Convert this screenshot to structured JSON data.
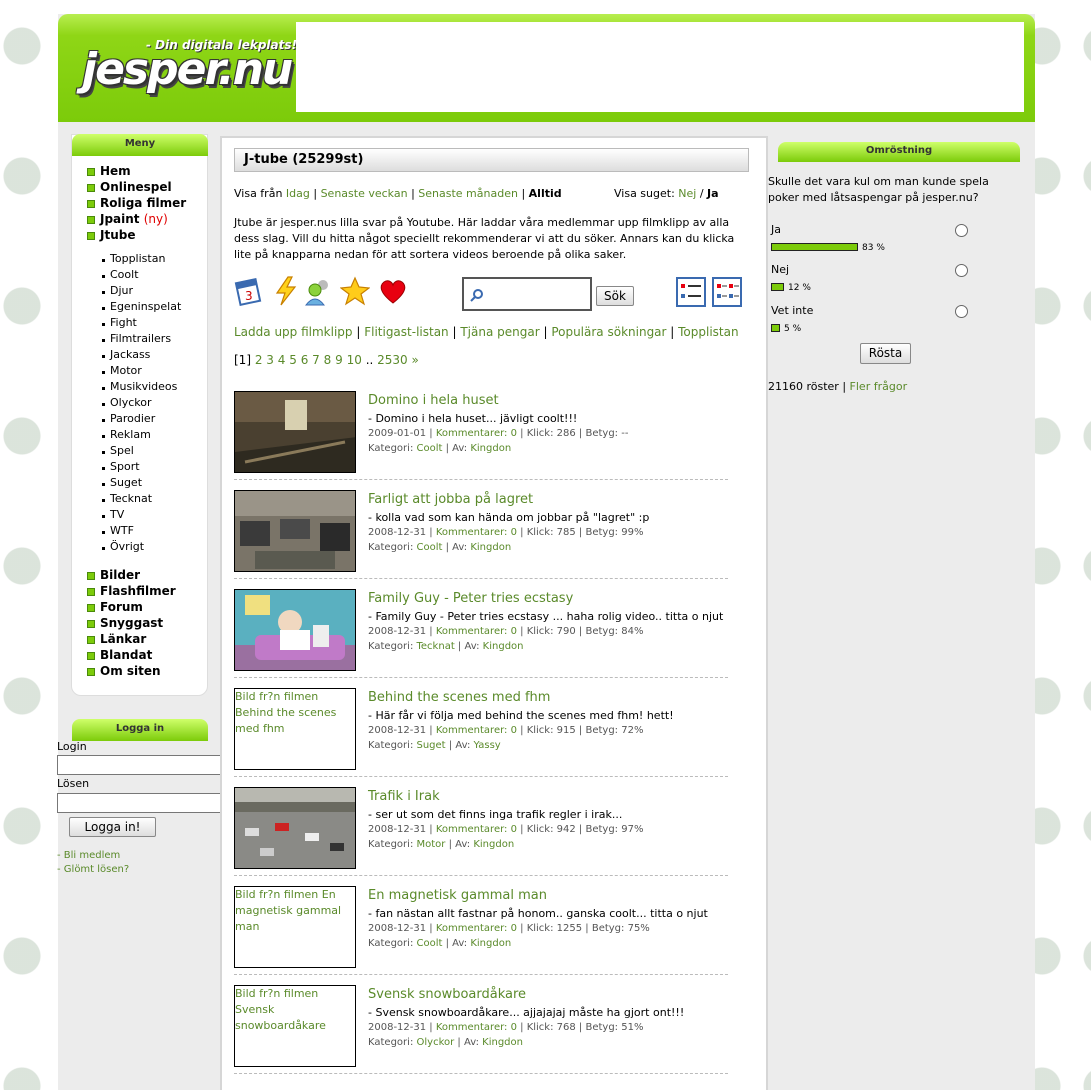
{
  "site": {
    "logo_text": "jesper.nu",
    "tagline": "- Din digitala lekplats!"
  },
  "menu": {
    "title": "Meny",
    "main_items": [
      "Hem",
      "Onlinespel",
      "Roliga filmer"
    ],
    "jpaint": "Jpaint",
    "jpaint_new": "(ny)",
    "jtube": "Jtube",
    "sub_items": [
      "Topplistan",
      "Coolt",
      "Djur",
      "Egeninspelat",
      "Fight",
      "Filmtrailers",
      "Jackass",
      "Motor",
      "Musikvideos",
      "Olyckor",
      "Parodier",
      "Reklam",
      "Spel",
      "Sport",
      "Suget",
      "Tecknat",
      "TV",
      "WTF",
      "Övrigt"
    ],
    "bottom_items": [
      "Bilder",
      "Flashfilmer",
      "Forum",
      "Snyggast",
      "Länkar",
      "Blandat",
      "Om siten"
    ]
  },
  "login": {
    "title": "Logga in",
    "login_label": "Login",
    "password_label": "Lösen",
    "button": "Logga in!",
    "register": "- Bli medlem",
    "forgot": "- Glömt lösen?"
  },
  "content": {
    "title": "J-tube (25299st)",
    "show_from_label": "Visa från",
    "filters": [
      "Idag",
      "Senaste veckan",
      "Senaste månaden",
      "Alltid"
    ],
    "show_suget_label": "Visa suget:",
    "suget_no": "Nej",
    "suget_yes": "Ja",
    "intro": "Jtube är jesper.nus lilla svar på Youtube. Här laddar våra medlemmar upp filmklipp av alla dess slag. Vill du hitta något speciellt rekommenderar vi att du söker. Annars kan du klicka lite på knapparna nedan för att sortera videos beroende på olika saker.",
    "search_button": "Sök",
    "links": [
      "Ladda upp filmklipp",
      "Flitigast-listan",
      "Tjäna pengar",
      "Populära sökningar",
      "Topplistan"
    ],
    "pagination": {
      "current": "[1]",
      "pages": [
        "2",
        "3",
        "4",
        "5",
        "6",
        "7",
        "8",
        "9",
        "10"
      ],
      "dots": "..",
      "last": "2530 »"
    },
    "videos": [
      {
        "title": "Domino i hela huset",
        "desc": "- Domino i hela huset... jävligt coolt!!!",
        "date": "2009-01-01",
        "comments": "Kommentarer: 0",
        "clicks": "Klick: 286",
        "rating": "Betyg: --",
        "category": "Coolt",
        "author": "Kingdon",
        "thumb_alt": ""
      },
      {
        "title": "Farligt att jobba på lagret",
        "desc": "- kolla vad som kan hända om jobbar på \"lagret\" :p",
        "date": "2008-12-31",
        "comments": "Kommentarer: 0",
        "clicks": "Klick: 785",
        "rating": "Betyg: 99%",
        "category": "Coolt",
        "author": "Kingdon",
        "thumb_alt": ""
      },
      {
        "title": "Family Guy - Peter tries ecstasy",
        "desc": "- Family Guy - Peter tries ecstasy ... haha rolig video.. titta o njut",
        "date": "2008-12-31",
        "comments": "Kommentarer: 0",
        "clicks": "Klick: 790",
        "rating": "Betyg: 84%",
        "category": "Tecknat",
        "author": "Kingdon",
        "thumb_alt": ""
      },
      {
        "title": "Behind the scenes med fhm",
        "desc": "- Här får vi följa med behind the scenes med fhm! hett!",
        "date": "2008-12-31",
        "comments": "Kommentarer: 0",
        "clicks": "Klick: 915",
        "rating": "Betyg: 72%",
        "category": "Suget",
        "author": "Yassy",
        "thumb_alt": "Bild fr?n filmen Behind the scenes med fhm"
      },
      {
        "title": "Trafik i Irak",
        "desc": "- ser ut som det finns inga trafik regler i irak...",
        "date": "2008-12-31",
        "comments": "Kommentarer: 0",
        "clicks": "Klick: 942",
        "rating": "Betyg: 97%",
        "category": "Motor",
        "author": "Kingdon",
        "thumb_alt": ""
      },
      {
        "title": "En magnetisk gammal man",
        "desc": "- fan nästan allt fastnar på honom.. ganska coolt... titta o njut",
        "date": "2008-12-31",
        "comments": "Kommentarer: 0",
        "clicks": "Klick: 1255",
        "rating": "Betyg: 75%",
        "category": "Coolt",
        "author": "Kingdon",
        "thumb_alt": "Bild fr?n filmen En magnetisk gammal man"
      },
      {
        "title": "Svensk snowboardåkare",
        "desc": "- Svensk snowboardåkare... ajjajajaj måste ha gjort ont!!!",
        "date": "2008-12-31",
        "comments": "Kommentarer: 0",
        "clicks": "Klick: 768",
        "rating": "Betyg: 51%",
        "category": "Olyckor",
        "author": "Kingdon",
        "thumb_alt": "Bild fr?n filmen Svensk snowboardåkare"
      }
    ],
    "category_label": "Kategori:",
    "author_label": "Av:"
  },
  "poll": {
    "title": "Omröstning",
    "question": "Skulle det vara kul om man kunde spela poker med låtsaspengar på jesper.nu?",
    "options": [
      {
        "label": "Ja",
        "percent": 83,
        "percent_text": "83 %"
      },
      {
        "label": "Nej",
        "percent": 12,
        "percent_text": "12 %"
      },
      {
        "label": "Vet inte",
        "percent": 5,
        "percent_text": "5 %"
      }
    ],
    "vote_button": "Rösta",
    "votes": "21160 röster",
    "more": "Fler frågor"
  },
  "colors": {
    "accent": "#7ccb0a",
    "link": "#5a8a2a",
    "new": "#e00000"
  }
}
